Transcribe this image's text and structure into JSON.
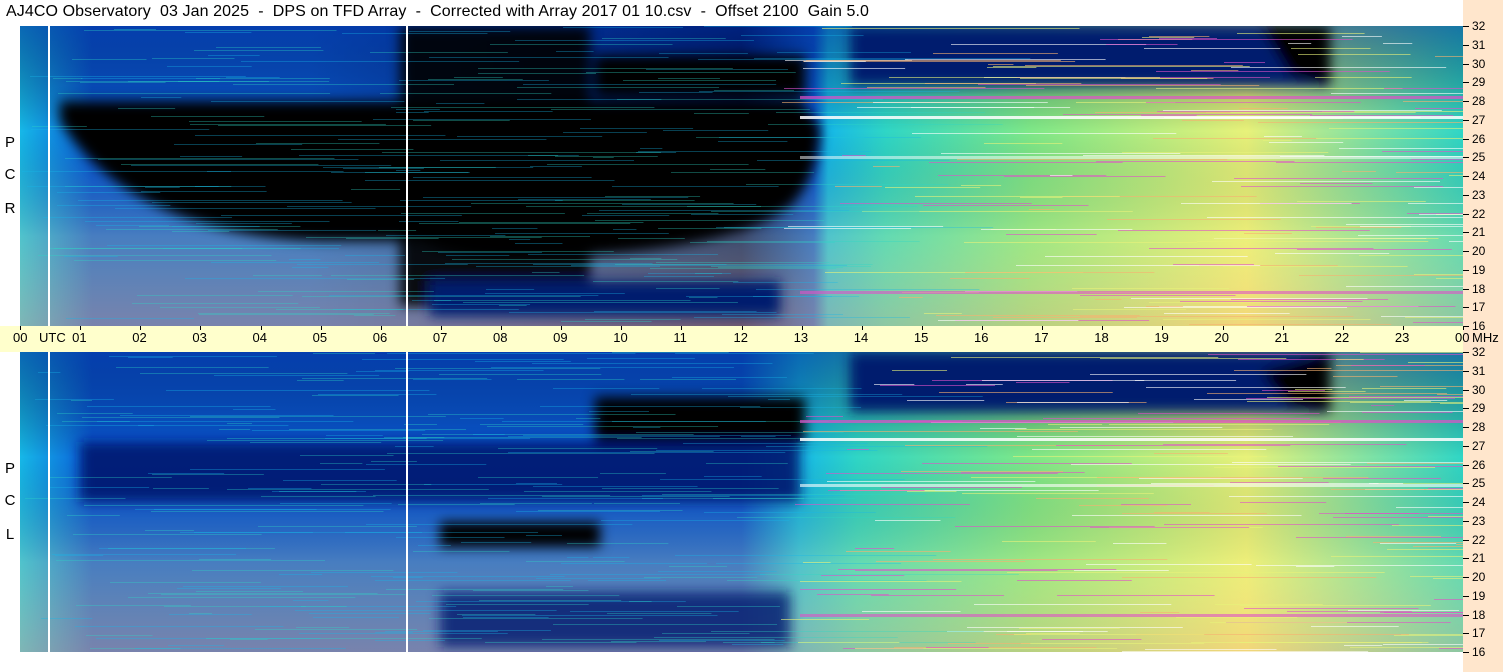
{
  "title": "AJ4CO Observatory  03 Jan 2025  -  DPS on TFD Array  -  Corrected with Array 2017 01 10.csv  -  Offset 2100  Gain 5.0",
  "chart_data": [
    {
      "type": "heatmap",
      "panel": "RCP",
      "side_label": [
        "R",
        "C",
        "P"
      ],
      "x_axis": "UTC",
      "y_axis": "MHz",
      "y_range": [
        16,
        32
      ]
    },
    {
      "type": "heatmap",
      "panel": "LCP",
      "side_label": [
        "L",
        "C",
        "P"
      ],
      "x_axis": "UTC",
      "y_axis": "MHz",
      "y_range": [
        16,
        32
      ]
    }
  ],
  "time_axis": {
    "labels": [
      "00",
      "01",
      "02",
      "03",
      "04",
      "05",
      "06",
      "07",
      "08",
      "09",
      "10",
      "11",
      "12",
      "13",
      "14",
      "15",
      "16",
      "17",
      "18",
      "19",
      "20",
      "21",
      "22",
      "23",
      "00"
    ],
    "utc_label": "UTC",
    "unit_label": "MHz"
  },
  "freq_axis": {
    "ticks": [
      32,
      31,
      30,
      29,
      28,
      27,
      26,
      25,
      24,
      23,
      22,
      21,
      20,
      19,
      18,
      17,
      16
    ]
  },
  "colors": {
    "black": "#000000",
    "deep_blue": "#001a6e",
    "blue": "#0a5ad8",
    "cyan": "#16b8e8",
    "teal": "#2fd6c6",
    "green": "#7ee888",
    "yellow": "#e8f27a",
    "orange": "#f6b070",
    "magenta": "#e050c8",
    "white": "#ffffff",
    "freq_strip": "#ffe6cc",
    "time_strip": "#ffffcc"
  }
}
